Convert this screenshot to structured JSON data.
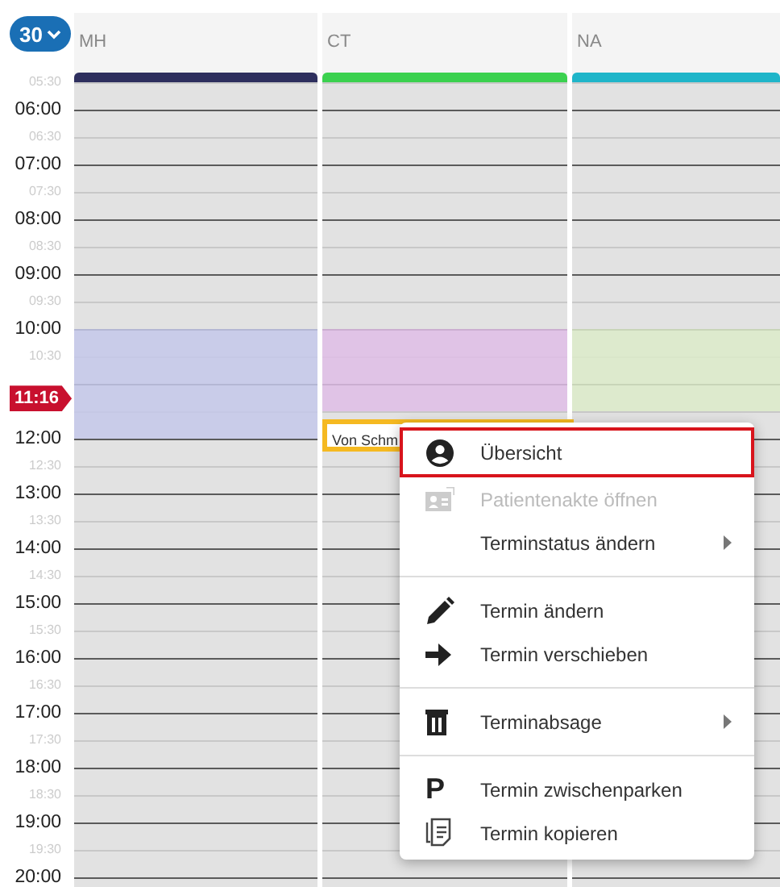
{
  "interval_button": {
    "label": "30"
  },
  "columns": [
    {
      "name": "MH",
      "color": "#2e2f5e"
    },
    {
      "name": "CT",
      "color": "#3bd14f"
    },
    {
      "name": "NA",
      "color": "#1fb5c9"
    }
  ],
  "times_morning": [
    "05:30",
    "06:00",
    "06:30",
    "07:00",
    "07:30",
    "08:00",
    "08:30",
    "09:00",
    "09:30",
    "10:00",
    "10:30"
  ],
  "times_afternoon": [
    "12:00",
    "12:30",
    "13:00",
    "13:30",
    "14:00",
    "14:30",
    "15:00",
    "15:30",
    "16:00",
    "16:30",
    "17:00",
    "17:30",
    "18:00",
    "18:30",
    "19:00",
    "19:30",
    "20:00"
  ],
  "appointments": [
    {
      "color": "#c4c8ea"
    },
    {
      "color": "#dfbde6"
    },
    {
      "color": "#dcebc9"
    },
    {
      "color": "#ffffff",
      "label": "Von Schm"
    }
  ],
  "current_time": "11:16",
  "context_menu": [
    {
      "kind": "item",
      "label": "Übersicht",
      "selected": true,
      "disabled": false,
      "submenu": false
    },
    {
      "kind": "item",
      "label": "Patientenakte öffnen",
      "selected": false,
      "disabled": true,
      "submenu": false
    },
    {
      "kind": "item",
      "label": "Terminstatus ändern",
      "selected": false,
      "disabled": false,
      "submenu": true
    },
    {
      "kind": "divider"
    },
    {
      "kind": "item",
      "label": "Termin ändern",
      "selected": false,
      "disabled": false,
      "submenu": false
    },
    {
      "kind": "item",
      "label": "Termin verschieben",
      "selected": false,
      "disabled": false,
      "submenu": false
    },
    {
      "kind": "divider"
    },
    {
      "kind": "item",
      "label": "Terminabsage",
      "selected": false,
      "disabled": false,
      "submenu": true
    },
    {
      "kind": "divider"
    },
    {
      "kind": "item",
      "glyph": "P",
      "label": "Termin zwischenparken",
      "selected": false,
      "disabled": false,
      "submenu": false
    },
    {
      "kind": "item",
      "label": "Termin kopieren",
      "selected": false,
      "disabled": false,
      "submenu": false
    }
  ]
}
